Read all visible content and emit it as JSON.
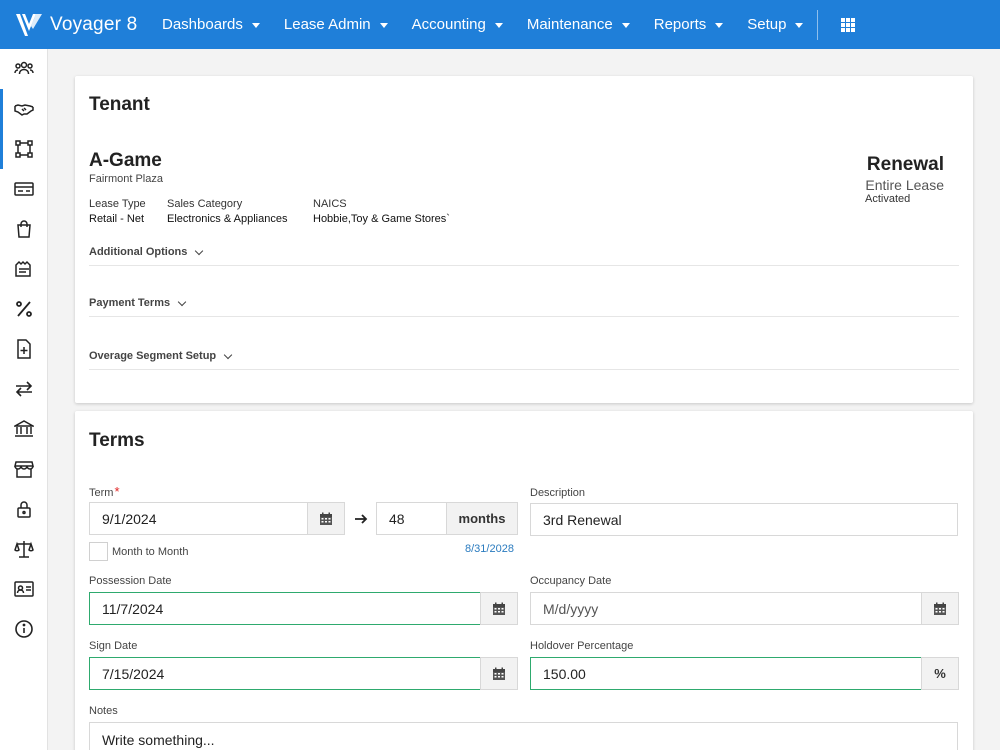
{
  "brand": {
    "name": "Voyager 8"
  },
  "nav": {
    "items": [
      {
        "label": "Dashboards"
      },
      {
        "label": "Lease Admin"
      },
      {
        "label": "Accounting"
      },
      {
        "label": "Maintenance"
      },
      {
        "label": "Reports"
      },
      {
        "label": "Setup"
      }
    ]
  },
  "sidebar": {
    "items": [
      {
        "icon": "users-icon",
        "active": false
      },
      {
        "icon": "handshake-icon",
        "active": true
      },
      {
        "icon": "vector-square-icon",
        "active": true
      },
      {
        "icon": "billing-icon",
        "active": false
      },
      {
        "icon": "shopping-bag-icon",
        "active": false
      },
      {
        "icon": "invoice-icon",
        "active": false
      },
      {
        "icon": "percent-icon",
        "active": false
      },
      {
        "icon": "file-plus-icon",
        "active": false
      },
      {
        "icon": "exchange-icon",
        "active": false
      },
      {
        "icon": "bank-icon",
        "active": false
      },
      {
        "icon": "store-icon",
        "active": false
      },
      {
        "icon": "lock-icon",
        "active": false
      },
      {
        "icon": "balance-scale-icon",
        "active": false
      },
      {
        "icon": "id-card-icon",
        "active": false
      },
      {
        "icon": "info-icon",
        "active": false
      }
    ]
  },
  "tenant": {
    "title": "Tenant",
    "name": "A-Game",
    "property": "Fairmont Plaza",
    "lease_type_label": "Lease Type",
    "lease_type": "Retail - Net",
    "sales_category_label": "Sales Category",
    "sales_category": "Electronics & Appliances",
    "naics_label": "NAICS",
    "naics": "Hobbie,Toy & Game Stores`",
    "status_title": "Renewal",
    "status_scope": "Entire Lease",
    "status_state": "Activated",
    "sections": [
      {
        "label": "Additional Options"
      },
      {
        "label": "Payment Terms"
      },
      {
        "label": "Overage Segment Setup"
      }
    ]
  },
  "terms": {
    "title": "Terms",
    "term_label": "Term",
    "term_required": "*",
    "term_start": "9/1/2024",
    "term_length": "48",
    "term_unit": "months",
    "term_end": "8/31/2028",
    "month_to_month_label": "Month to Month",
    "description_label": "Description",
    "description": "3rd Renewal",
    "possession_label": "Possession Date",
    "possession_date": "11/7/2024",
    "occupancy_label": "Occupancy Date",
    "occupancy_placeholder": "M/d/yyyy",
    "sign_label": "Sign Date",
    "sign_date": "7/15/2024",
    "holdover_label": "Holdover Percentage",
    "holdover": "150.00",
    "holdover_unit": "%",
    "notes_label": "Notes",
    "notes_placeholder": "Write something..."
  },
  "colors": {
    "nav_bg": "#1f7fd9",
    "active_border": "#2eaa6e",
    "link": "#2a7bbf",
    "required": "#e02424"
  }
}
